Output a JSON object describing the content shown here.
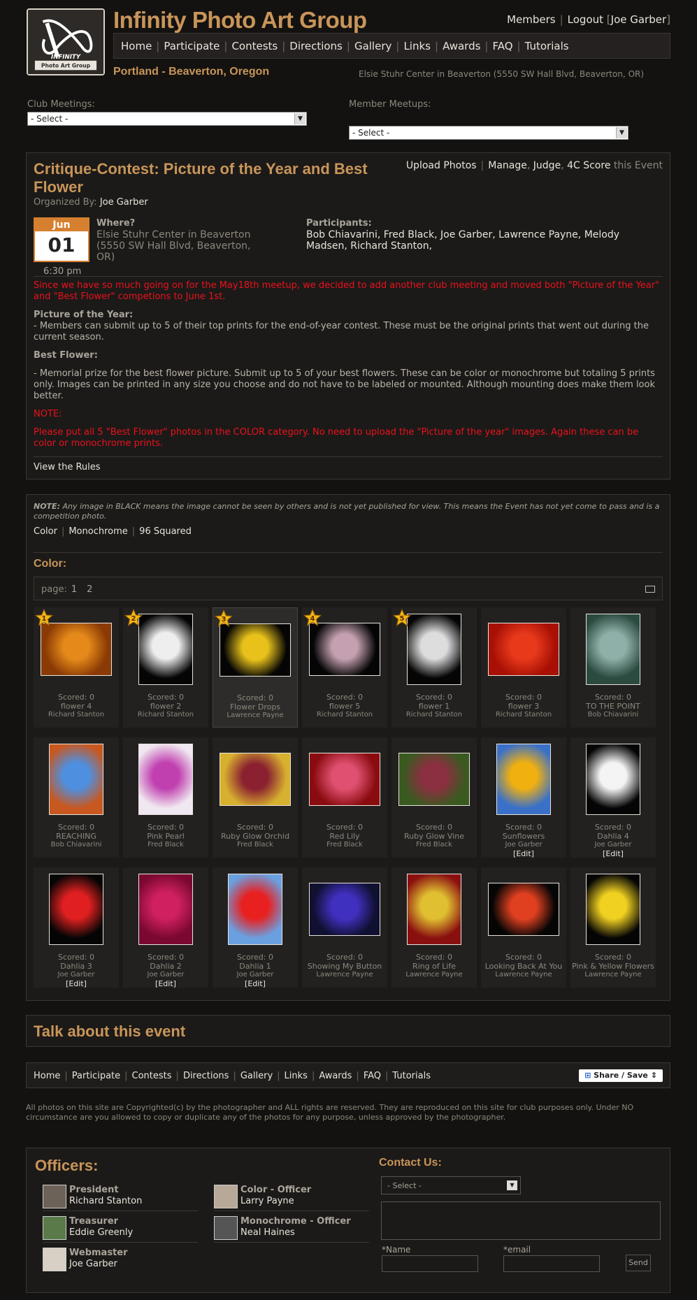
{
  "header": {
    "site_title": "Infinity Photo Art Group",
    "logo_text": "INFINITY Photo Art Group",
    "member_links": [
      "Members",
      "Logout"
    ],
    "user": "Joe Garber",
    "location": "Portland - Beaverton, Oregon",
    "venue": "Elsie Stuhr Center in Beaverton (5550 SW Hall Blvd, Beaverton, OR)"
  },
  "nav": [
    "Home",
    "Participate",
    "Contests",
    "Directions",
    "Gallery",
    "Links",
    "Awards",
    "FAQ",
    "Tutorials"
  ],
  "selects": {
    "club_label": "Club Meetings:",
    "club_value": "- Select -",
    "member_label": "Member Meetups:",
    "member_value": "- Select -"
  },
  "event": {
    "title": "Critique-Contest: Picture of the Year and Best Flower",
    "actions": [
      "Upload Photos",
      "Manage",
      "Judge",
      "4C Score"
    ],
    "actions_suffix": "this Event",
    "organized_label": "Organized By:",
    "organizer": "Joe Garber",
    "month": "Jun",
    "day": "01",
    "time": "6:30 pm",
    "where_label": "Where?",
    "where_value": "Elsie Stuhr Center in Beaverton (5550 SW Hall Blvd, Beaverton, OR)",
    "participants_label": "Participants:",
    "participants": "Bob Chiavarini, Fred Black, Joe Garber, Lawrence Payne, Melody Madsen, Richard Stanton,",
    "notice": "Since we have so much going on for the May18th meetup, we decided to add another club meeting and moved both \"Picture of the Year\" and  \"Best Flower\" competions to June 1st.",
    "poty_label": "Picture of the Year:",
    "poty_text": "- Members can submit up to 5 of their top prints for the end-of-year contest. These must be the original prints that went out during the current season.",
    "bf_label": "Best Flower:",
    "bf_text": "- Memorial prize for the best flower picture. Submit up to 5 of your best flowers. These can be color or monochrome but totaling 5 prints only. Images can be printed in any size you choose and do not have to be labeled or mounted. Although mounting does make them look better.",
    "note_label": "NOTE:",
    "note_text": "Please put all 5 \"Best Flower\" photos in the COLOR category. No need to upload the \"Picture of the year\" images. Again these can be color or monochrome prints.",
    "rules_link": "View the Rules"
  },
  "gallery": {
    "note_label": "NOTE:",
    "note_text": " Any image in BLACK means the image cannot be seen by others and is not yet published for view. This means the Event has not yet come to pass and is a competition photo.",
    "tabs": [
      "Color",
      "Monochrome",
      "96 Squared"
    ],
    "section": "Color:",
    "pager_label": "page:",
    "pages": [
      "1",
      "2"
    ],
    "edit_label": "[Edit]",
    "items": [
      {
        "score": "Scored: 0",
        "title": "flower 4",
        "by": "Richard Stanton",
        "rank": "1",
        "edit": false,
        "colors": [
          "#e58a1a",
          "#8a3a05"
        ],
        "shape": "land"
      },
      {
        "score": "Scored: 0",
        "title": "flower 2",
        "by": "Richard Stanton",
        "rank": "2",
        "edit": false,
        "colors": [
          "#eeeeee",
          "#050505"
        ],
        "shape": "port"
      },
      {
        "score": "Scored: 0",
        "title": "Flower Drops",
        "by": "Lawrence Payne",
        "rank": "3",
        "edit": false,
        "colors": [
          "#e8c21b",
          "#050505"
        ],
        "shape": "land"
      },
      {
        "score": "Scored: 0",
        "title": "flower 5",
        "by": "Richard Stanton",
        "rank": "4",
        "edit": false,
        "colors": [
          "#c4a0b0",
          "#050505"
        ],
        "shape": "land"
      },
      {
        "score": "Scored: 0",
        "title": "flower 1",
        "by": "Richard Stanton",
        "rank": "5",
        "edit": false,
        "colors": [
          "#dddddd",
          "#050505"
        ],
        "shape": "port"
      },
      {
        "score": "Scored: 0",
        "title": "flower 3",
        "by": "Richard Stanton",
        "rank": "",
        "edit": false,
        "colors": [
          "#e8391b",
          "#a81005"
        ],
        "shape": "land"
      },
      {
        "score": "Scored: 0",
        "title": "TO THE POINT",
        "by": "Bob Chiavarini",
        "rank": "",
        "edit": false,
        "colors": [
          "#8fb0a8",
          "#2b4a40"
        ],
        "shape": "port"
      },
      {
        "score": "Scored: 0",
        "title": "REACHING",
        "by": "Bob Chiavarini",
        "rank": "",
        "edit": false,
        "colors": [
          "#4f8fdf",
          "#c85820"
        ],
        "shape": "port"
      },
      {
        "score": "Scored: 0",
        "title": "Pink Pearl",
        "by": "Fred Black",
        "rank": "",
        "edit": false,
        "colors": [
          "#c040b0",
          "#f0e8f0"
        ],
        "shape": "port"
      },
      {
        "score": "Scored: 0",
        "title": "Ruby Glow Orchid",
        "by": "Fred Black",
        "rank": "",
        "edit": false,
        "colors": [
          "#8a2030",
          "#d8b030"
        ],
        "shape": "land"
      },
      {
        "score": "Scored: 0",
        "title": "Red Lily",
        "by": "Fred Black",
        "rank": "",
        "edit": false,
        "colors": [
          "#e05070",
          "#8a0c10"
        ],
        "shape": "land"
      },
      {
        "score": "Scored: 0",
        "title": "Ruby Glow Vine",
        "by": "Fred Black",
        "rank": "",
        "edit": false,
        "colors": [
          "#8a3040",
          "#3a5a20"
        ],
        "shape": "land"
      },
      {
        "score": "Scored: 0",
        "title": "Sunflowers",
        "by": "Joe Garber",
        "rank": "",
        "edit": true,
        "colors": [
          "#f0b010",
          "#3a70c8"
        ],
        "shape": "port"
      },
      {
        "score": "Scored: 0",
        "title": "Dahlia 4",
        "by": "Joe Garber",
        "rank": "",
        "edit": true,
        "colors": [
          "#f4f4f4",
          "#050505"
        ],
        "shape": "port"
      },
      {
        "score": "Scored: 0",
        "title": "Dahlia 3",
        "by": "Joe Garber",
        "rank": "",
        "edit": true,
        "colors": [
          "#e02020",
          "#050505"
        ],
        "shape": "port"
      },
      {
        "score": "Scored: 0",
        "title": "Dahlia 2",
        "by": "Joe Garber",
        "rank": "",
        "edit": true,
        "colors": [
          "#d02060",
          "#7a0830"
        ],
        "shape": "port"
      },
      {
        "score": "Scored: 0",
        "title": "Dahlia 1",
        "by": "Joe Garber",
        "rank": "",
        "edit": true,
        "colors": [
          "#e82020",
          "#6aa0e0"
        ],
        "shape": "port"
      },
      {
        "score": "Scored: 0",
        "title": "Showing My Button",
        "by": "Lawrence Payne",
        "rank": "",
        "edit": false,
        "colors": [
          "#4030c0",
          "#101030"
        ],
        "shape": "land"
      },
      {
        "score": "Scored: 0",
        "title": "Ring of Life",
        "by": "Lawrence Payne",
        "rank": "",
        "edit": false,
        "colors": [
          "#e0c030",
          "#8a1010"
        ],
        "shape": "port"
      },
      {
        "score": "Scored: 0",
        "title": "Looking Back At You",
        "by": "Lawrence Payne",
        "rank": "",
        "edit": false,
        "colors": [
          "#e04020",
          "#050505"
        ],
        "shape": "land"
      },
      {
        "score": "Scored: 0",
        "title": "Pink & Yellow Flowers",
        "by": "Lawrence Payne",
        "rank": "",
        "edit": false,
        "colors": [
          "#f0d020",
          "#050505"
        ],
        "shape": "port"
      }
    ]
  },
  "talk": "Talk about this event",
  "share": "Share / Save",
  "copyright": "All photos on this site are Copyrighted(c) by the photographer and ALL rights are reserved. They are reproduced on this site for club purposes only. Under NO circumstance are you allowed to copy or duplicate any of the photos for any purpose, unless approved by the photographer.",
  "officers": {
    "heading": "Officers:",
    "list": [
      {
        "role": "President",
        "name": "Richard Stanton"
      },
      {
        "role": "Color - Officer",
        "name": "Larry Payne"
      },
      {
        "role": "Treasurer",
        "name": "Eddie Greenly"
      },
      {
        "role": "Monochrome - Officer",
        "name": "Neal Haines"
      },
      {
        "role": "Webmaster",
        "name": "Joe Garber"
      }
    ]
  },
  "contact": {
    "heading": "Contact Us:",
    "select": "- Select -",
    "name_label": "*Name",
    "email_label": "*email",
    "send": "Send"
  },
  "colors": {
    "accent": "#c8955a",
    "notice_red": "#e8121d",
    "date_orange": "#d6802f",
    "background": "#141210"
  }
}
